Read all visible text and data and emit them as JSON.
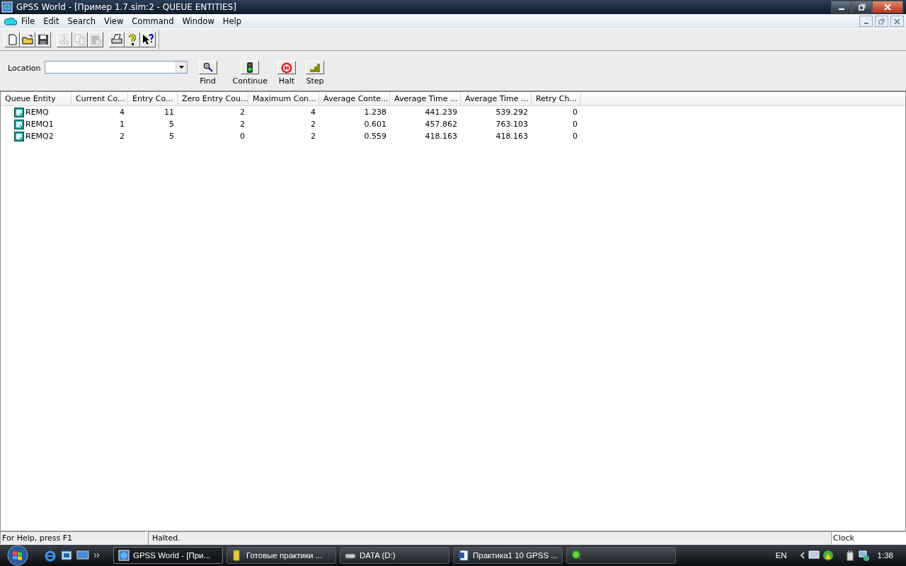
{
  "window": {
    "title": "GPSS World - [Пример 1.7.sim:2  -  QUEUE ENTITIES]"
  },
  "menu": [
    "File",
    "Edit",
    "Search",
    "View",
    "Command",
    "Window",
    "Help"
  ],
  "toolbar": [
    {
      "kind": "new",
      "disabled": false
    },
    {
      "kind": "open",
      "disabled": false
    },
    {
      "kind": "save",
      "disabled": false
    },
    {
      "kind": "cut",
      "disabled": true
    },
    {
      "kind": "copy",
      "disabled": true
    },
    {
      "kind": "paste",
      "disabled": true
    },
    {
      "kind": "print",
      "disabled": false
    },
    {
      "kind": "help",
      "disabled": false
    },
    {
      "kind": "context-help",
      "disabled": false
    }
  ],
  "sim_bar": {
    "location_label": "Location",
    "buttons": [
      {
        "kind": "find",
        "label": "Find"
      },
      {
        "kind": "continue",
        "label": "Continue"
      },
      {
        "kind": "halt",
        "label": "Halt"
      },
      {
        "kind": "step",
        "label": "Step"
      }
    ]
  },
  "table": {
    "columns": [
      "Queue Entity",
      "Current Co...",
      "Entry Co...",
      "Zero Entry Cou...",
      "Maximum Con...",
      "Average Conte...",
      "Average Time ...",
      "Average Time ...",
      "Retry Ch..."
    ],
    "rows": [
      [
        "REMQ",
        "4",
        "11",
        "2",
        "4",
        "1.238",
        "441.239",
        "539.292",
        "0"
      ],
      [
        "REMQ1",
        "1",
        "5",
        "2",
        "2",
        "0.601",
        "457.862",
        "763.103",
        "0"
      ],
      [
        "REMQ2",
        "2",
        "5",
        "0",
        "2",
        "0.559",
        "418.163",
        "418.163",
        "0"
      ]
    ]
  },
  "status_bar": {
    "help": "For Help, press F1",
    "state": "Halted.",
    "clock": "Clock"
  },
  "taskbar": {
    "items": [
      {
        "kind": "app",
        "label": "GPSS World - [При...",
        "selected": true
      },
      {
        "kind": "folder",
        "label": "Готовые практики ...",
        "selected": false
      },
      {
        "kind": "drive",
        "label": "DATA (D:)",
        "selected": false
      },
      {
        "kind": "word",
        "label": "Практика1 10 GPSS ...",
        "selected": false
      },
      {
        "kind": "search",
        "selected": false
      }
    ],
    "language": "EN",
    "time": "1:38"
  }
}
